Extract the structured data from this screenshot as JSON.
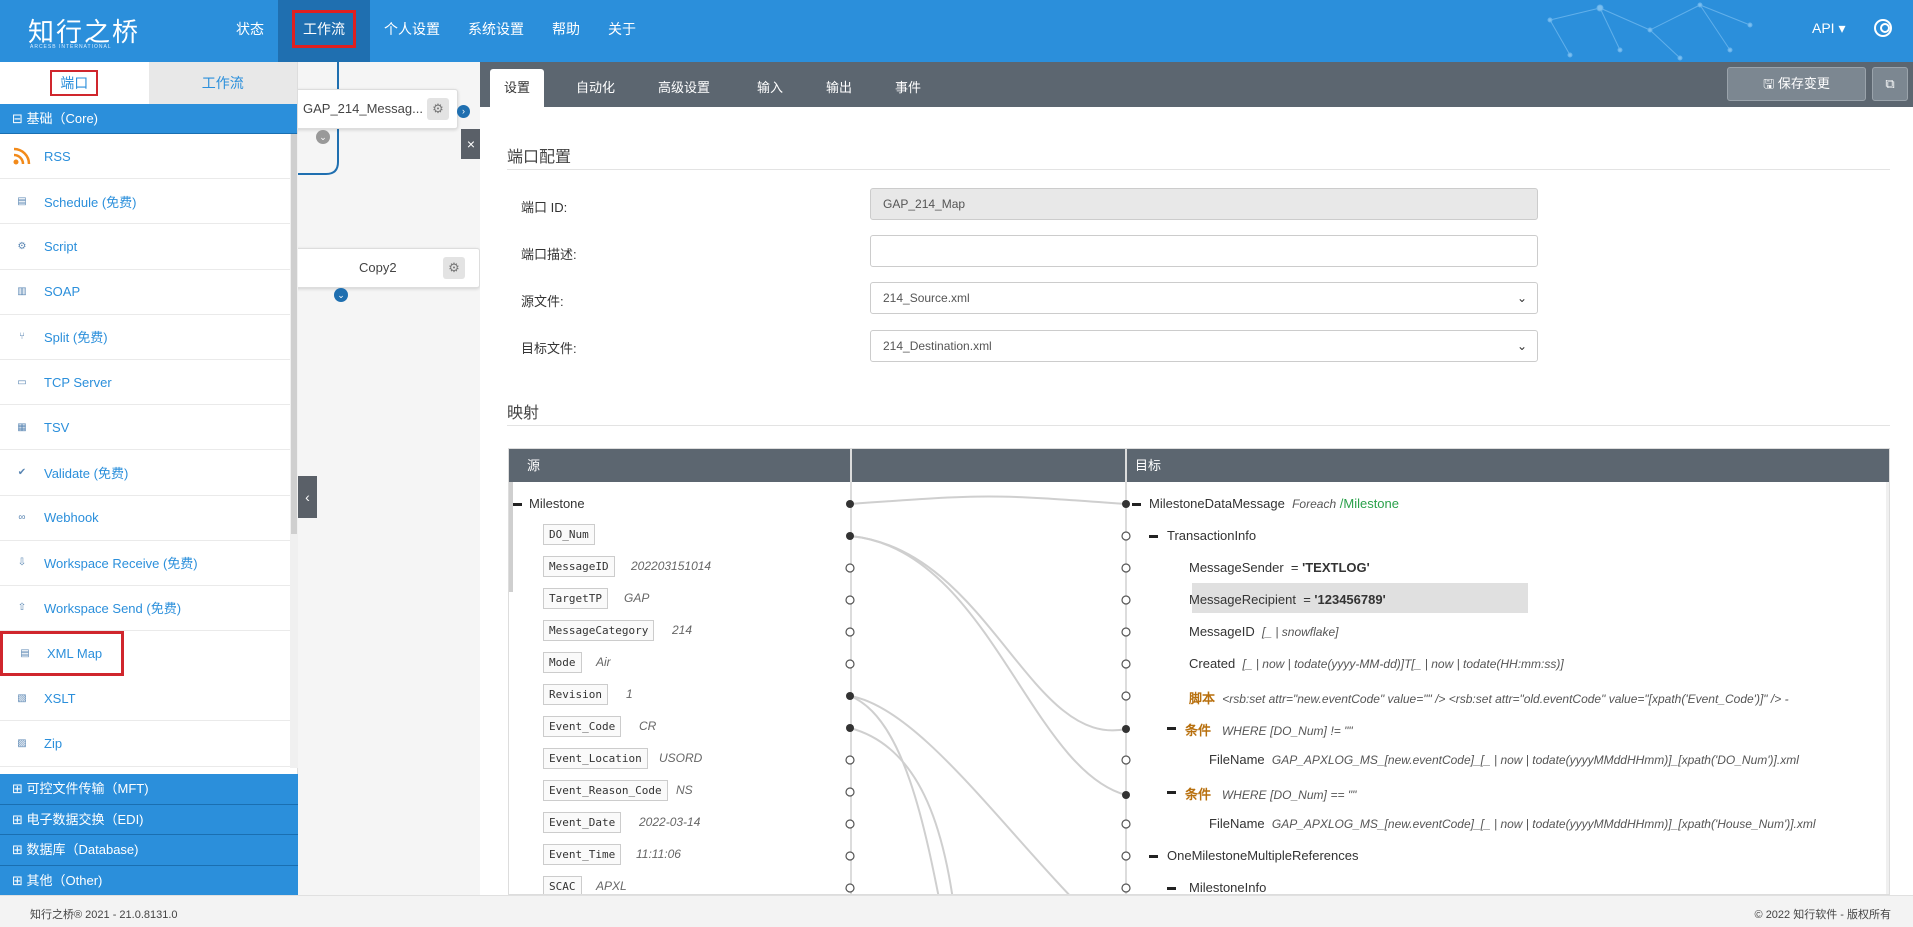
{
  "brand": {
    "logo": "知行之桥",
    "logo_sub": "ARCESB INTERNATIONAL"
  },
  "nav": [
    "状态",
    "工作流",
    "个人设置",
    "系统设置",
    "帮助",
    "关于"
  ],
  "topright": {
    "api": "API ▾"
  },
  "sidebar": {
    "tabs": [
      "端口",
      "工作流"
    ],
    "core_header": "⊟ 基础（Core)",
    "ports": [
      {
        "label": "RSS",
        "icon": "rss-icon"
      },
      {
        "label": "Schedule (免费)",
        "icon": "schedule-icon"
      },
      {
        "label": "Script",
        "icon": "script-icon"
      },
      {
        "label": "SOAP",
        "icon": "soap-icon"
      },
      {
        "label": "Split (免费)",
        "icon": "split-icon"
      },
      {
        "label": "TCP Server",
        "icon": "tcp-icon"
      },
      {
        "label": "TSV",
        "icon": "tsv-icon"
      },
      {
        "label": "Validate (免费)",
        "icon": "validate-icon"
      },
      {
        "label": "Webhook",
        "icon": "webhook-icon"
      },
      {
        "label": "Workspace Receive (免费)",
        "icon": "download-icon"
      },
      {
        "label": "Workspace Send (免费)",
        "icon": "upload-icon"
      },
      {
        "label": "XML Map",
        "icon": "xml-map-icon"
      },
      {
        "label": "XSLT",
        "icon": "xslt-icon"
      },
      {
        "label": "Zip",
        "icon": "zip-icon"
      }
    ],
    "bottom_cats": [
      "⊞ 可控文件传输（MFT)",
      "⊞ 电子数据交换（EDI)",
      "⊞ 数据库（Database)",
      "⊞ 其他（Other)"
    ]
  },
  "canvas": {
    "node1": "GAP_214_Messag...",
    "node2": "Copy2"
  },
  "tabs": [
    "设置",
    "自动化",
    "高级设置",
    "输入",
    "输出",
    "事件"
  ],
  "save_label": "保存变更",
  "port_config": {
    "title": "端口配置",
    "fields": [
      {
        "label": "端口 ID:",
        "value": "GAP_214_Map"
      },
      {
        "label": "端口描述:",
        "value": ""
      },
      {
        "label": "源文件:",
        "value": "214_Source.xml"
      },
      {
        "label": "目标文件:",
        "value": "214_Destination.xml"
      }
    ]
  },
  "mapping": {
    "title": "映射",
    "source_header": "源",
    "target_header": "目标",
    "source_root": "Milestone",
    "source_rows": [
      {
        "tag": "DO_Num",
        "value": ""
      },
      {
        "tag": "MessageID",
        "value": "202203151014"
      },
      {
        "tag": "TargetTP",
        "value": "GAP"
      },
      {
        "tag": "MessageCategory",
        "value": "214"
      },
      {
        "tag": "Mode",
        "value": "Air"
      },
      {
        "tag": "Revision",
        "value": "1"
      },
      {
        "tag": "Event_Code",
        "value": "CR"
      },
      {
        "tag": "Event_Location",
        "value": "USORD"
      },
      {
        "tag": "Event_Reason_Code",
        "value": "NS"
      },
      {
        "tag": "Event_Date",
        "value": "2022-03-14"
      },
      {
        "tag": "Event_Time",
        "value": "11:11:06"
      },
      {
        "tag": "SCAC",
        "value": "APXL"
      }
    ],
    "target": {
      "root": "MilestoneDataMessage",
      "root_foreach": "Foreach",
      "root_path": "/Milestone",
      "transaction": "TransactionInfo",
      "sender": "MessageSender",
      "sender_eq": "=",
      "sender_val": "'TEXTLOG'",
      "recipient": "MessageRecipient",
      "recipient_eq": "=",
      "recipient_val": "'123456789'",
      "msgid": "MessageID",
      "msgid_val": "[_ | snowflake]",
      "created": "Created",
      "created_val": "[_ | now | todate(yyyy-MM-dd)]T[_ | now | todate(HH:mm:ss)]",
      "script_kw": "脚本",
      "script_val": "<rsb:set attr=\"new.eventCode\" value=\"\" /> <rsb:set attr=\"old.eventCode\" value=\"[xpath('Event_Code')]\" /> -",
      "cond_kw": "条件",
      "where1_a": "WHERE",
      "where1_b": "[DO_Num]",
      "where1_c": "!= \"\"",
      "filename1": "FileName",
      "filename1_val": "GAP_APXLOG_MS_[new.eventCode]_[_ | now | todate(yyyyMMddHHmm)]_[xpath('DO_Num')].xml",
      "where2_a": "WHERE",
      "where2_b": "[DO_Num]",
      "where2_c": "== \"\"",
      "filename2": "FileName",
      "filename2_val": "GAP_APXLOG_MS_[new.eventCode]_[_ | now | todate(yyyyMMddHHmm)]_[xpath('House_Num')].xml",
      "multi": "OneMilestoneMultipleReferences",
      "milestone_info": "MilestoneInfo"
    }
  },
  "footer": {
    "left": "知行之桥® 2021 - 21.0.8131.0",
    "right": "© 2022 知行软件 - 版权所有"
  },
  "colors": {
    "brand": "#2b8fdb",
    "tabbar": "#5c6670",
    "highlight_red": "#d0262d"
  }
}
